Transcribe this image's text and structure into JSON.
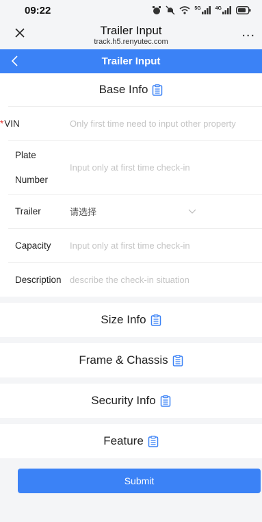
{
  "status": {
    "time": "09:22",
    "signal_5g": "5G",
    "signal_4g": "4G"
  },
  "browser": {
    "title": "Trailer Input",
    "url": "track.h5.renyutec.com",
    "more": "..."
  },
  "nav": {
    "title": "Trailer Input"
  },
  "base_info": {
    "heading": "Base Info",
    "fields": [
      {
        "label": "VIN",
        "required": "*",
        "placeholder": "Only first time need to input other property"
      },
      {
        "label_line1": "Plate",
        "label_line2": "Number",
        "placeholder": "Input only at first time check-in"
      },
      {
        "label": "Trailer",
        "value": "请选择"
      },
      {
        "label": "Capacity",
        "placeholder": "Input only at first time check-in"
      },
      {
        "label": "Description",
        "placeholder": "describe the check-in situation"
      }
    ]
  },
  "sections": [
    "Size Info",
    "Frame & Chassis",
    "Security Info",
    "Feature"
  ],
  "submit_label": "Submit",
  "colors": {
    "accent": "#3b82f6",
    "required": "#e53935"
  }
}
